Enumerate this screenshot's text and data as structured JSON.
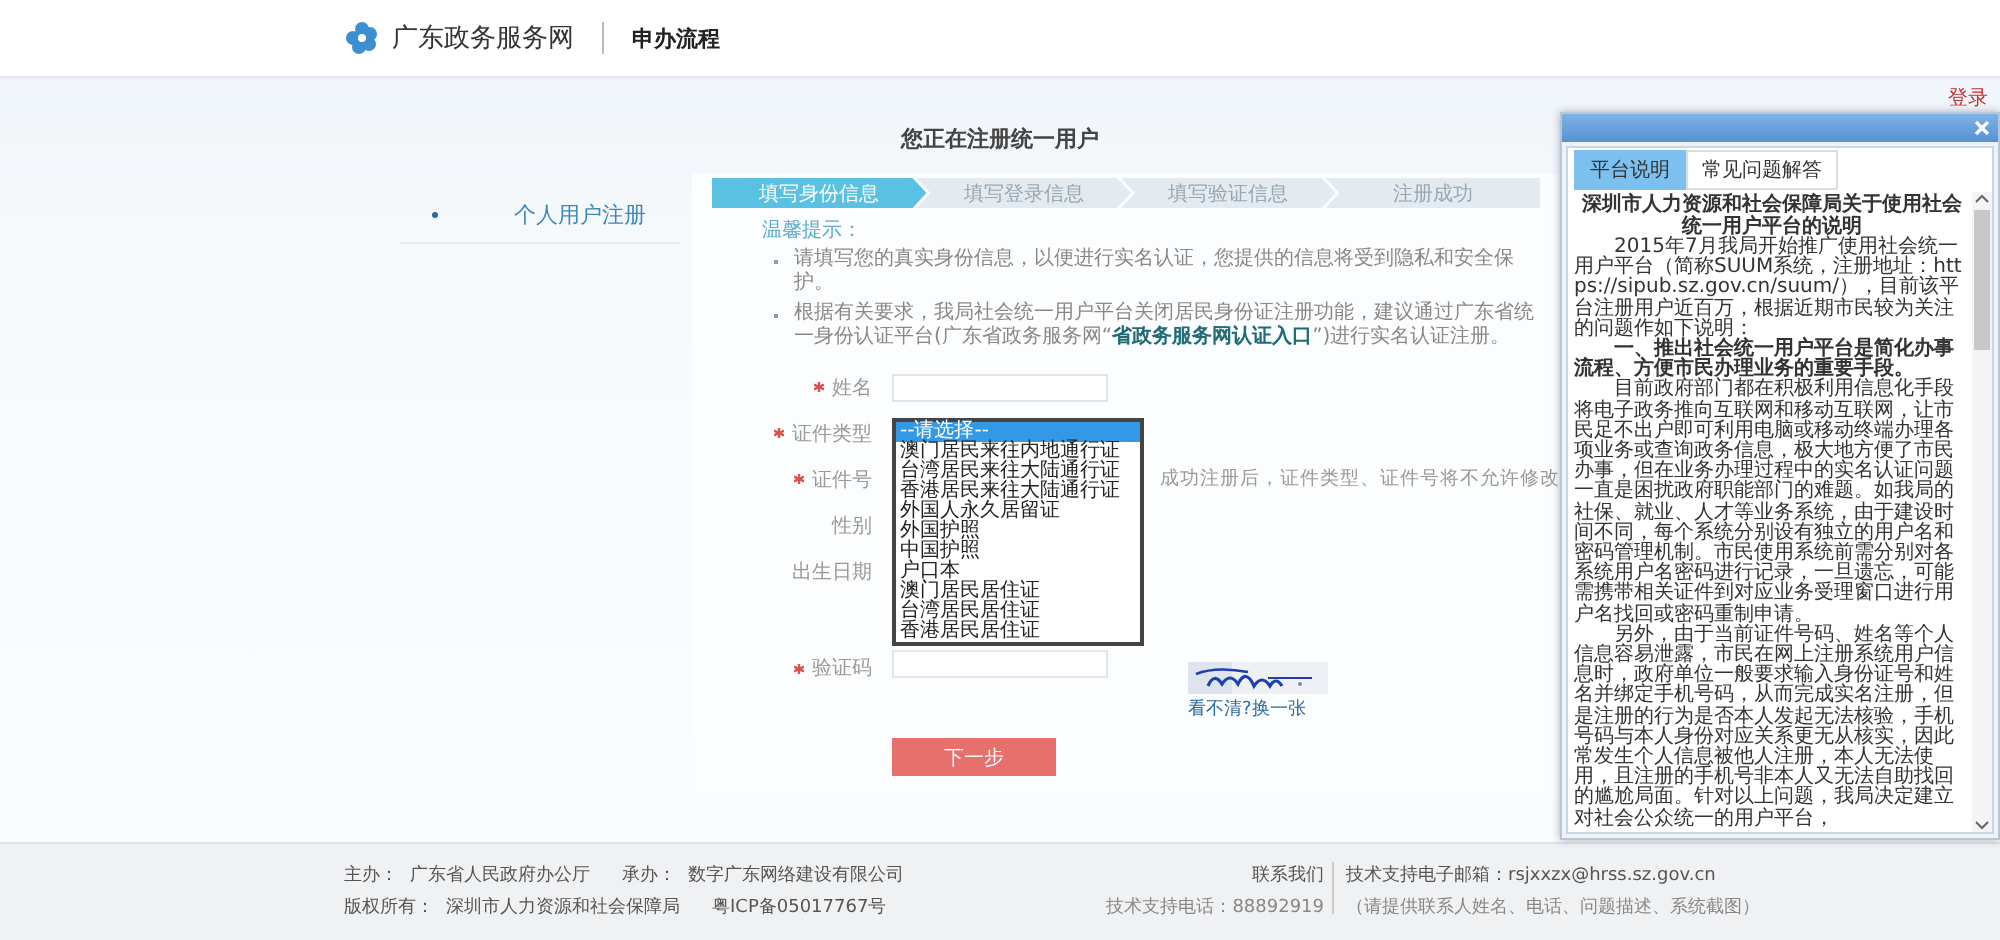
{
  "header": {
    "site_name": "广东政务服务网",
    "section": "申办流程"
  },
  "login_link": "登录",
  "page_title": "您正在注册统一用户",
  "sidebar": {
    "items": [
      {
        "label": "个人用户注册",
        "selected": true
      }
    ]
  },
  "steps": [
    {
      "label": "填写身份信息",
      "selected": true
    },
    {
      "label": "填写登录信息",
      "selected": false
    },
    {
      "label": "填写验证信息",
      "selected": false
    },
    {
      "label": "注册成功",
      "selected": false
    }
  ],
  "tips": {
    "title": "温馨提示：",
    "items": [
      {
        "before": "请填写您的真实身份信息，以便进行实名认证，您提供的信息将受到隐私和安全保护。"
      },
      {
        "before": "根据有关要求，我局社会统一用户平台关闭居民身份证注册功能，建议通过广东省统一身份认证平台(广东省政务服务网“",
        "link": "省政务服务网认证入口",
        "after": "”)进行实名认证注册。"
      }
    ]
  },
  "form": {
    "fields": [
      {
        "kind": "text",
        "label": "姓名",
        "required": true
      },
      {
        "kind": "select",
        "label": "证件类型",
        "required": true,
        "options": [
          {
            "label": "--请选择--",
            "selected": true
          },
          {
            "label": "澳门居民来往内地通行证",
            "selected": false
          },
          {
            "label": "台湾居民来往大陆通行证",
            "selected": false
          },
          {
            "label": "香港居民来往大陆通行证",
            "selected": false
          },
          {
            "label": "外国人永久居留证",
            "selected": false
          },
          {
            "label": "外国护照",
            "selected": false
          },
          {
            "label": "中国护照",
            "selected": false
          },
          {
            "label": "户口本",
            "selected": false
          },
          {
            "label": "澳门居民居住证",
            "selected": false
          },
          {
            "label": "台湾居民居住证",
            "selected": false
          },
          {
            "label": "香港居民居住证",
            "selected": false
          }
        ]
      },
      {
        "kind": "label",
        "label": "证件号",
        "required": true,
        "hint": "成功注册后，证件类型、证件号将不允许修改"
      },
      {
        "kind": "label",
        "label": "性别",
        "required": false
      },
      {
        "kind": "label",
        "label": "出生日期",
        "required": false
      },
      {
        "kind": "captcha",
        "label": "验证码",
        "required": true,
        "refresh_link": "看不清?换一张"
      }
    ],
    "submit": "下一步"
  },
  "popup": {
    "tabs": [
      {
        "label": "平台说明",
        "selected": true
      },
      {
        "label": "常见问题解答",
        "selected": false
      }
    ],
    "paragraphs": [
      {
        "kind": "title",
        "text": "深圳市人力资源和社会保障局关于使用社会统一用户平台的说明"
      },
      {
        "kind": "body",
        "text": "2015年7月我局开始推广使用社会统一用户平台（简称SUUM系统，注册地址：https://sipub.sz.gov.cn/suum/），目前该平台注册用户近百万，根据近期市民较为关注的问题作如下说明："
      },
      {
        "kind": "heading",
        "text": "一、推出社会统一用户平台是简化办事流程、方便市民办理业务的重要手段。"
      },
      {
        "kind": "body",
        "text": "目前政府部门都在积极利用信息化手段将电子政务推向互联网和移动互联网，让市民足不出户即可利用电脑或移动终端办理各项业务或查询政务信息，极大地方便了市民办事，但在业务办理过程中的实名认证问题一直是困扰政府职能部门的难题。如我局的社保、就业、人才等业务系统，由于建设时间不同，每个系统分别设有独立的用户名和密码管理机制。市民使用系统前需分别对各系统用户名密码进行记录，一旦遗忘，可能需携带相关证件到对应业务受理窗口进行用户名找回或密码重制申请。"
      },
      {
        "kind": "body",
        "text": "另外，由于当前证件号码、姓名等个人信息容易泄露，市民在网上注册系统用户信息时，政府单位一般要求输入身份证号和姓名并绑定手机号码，从而完成实名注册，但是注册的行为是否本人发起无法核验，手机号码与本人身份对应关系更无从核实，因此常发生个人信息被他人注册，本人无法使用，且注册的手机号非本人又无法自助找回的尴尬局面。针对以上问题，我局决定建立对社会公众统一的用户平台，"
      }
    ]
  },
  "footer": {
    "left": [
      [
        {
          "label": "主办：",
          "value": "广东省人民政府办公厅"
        },
        {
          "label": "承办：",
          "value": "数字广东网络建设有限公司"
        }
      ],
      [
        {
          "label": "版权所有：",
          "value": "深圳市人力资源和社会保障局"
        },
        {
          "value": "粤ICP备05017767号"
        }
      ]
    ],
    "contact": "联系我们",
    "phone": "技术支持电话：88892919",
    "email": "技术支持电子邮箱：rsjxxzx@hrss.sz.gov.cn",
    "email_note": "（请提供联系人姓名、电话、问题描述、系统截图）"
  }
}
